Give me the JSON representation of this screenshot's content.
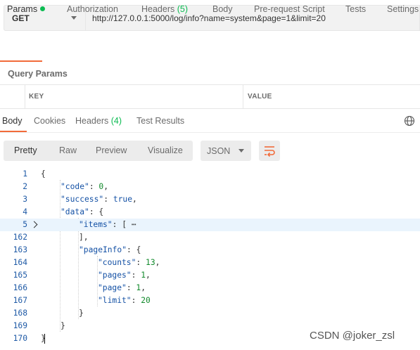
{
  "request": {
    "method": "GET",
    "url": "http://127.0.0.1:5000/log/info?name=system&page=1&limit=20"
  },
  "request_tabs": [
    {
      "label": "Params",
      "active": true,
      "indicator": "green-dot"
    },
    {
      "label": "Authorization"
    },
    {
      "label": "Headers",
      "count": "(5)"
    },
    {
      "label": "Body"
    },
    {
      "label": "Pre-request Script"
    },
    {
      "label": "Tests"
    },
    {
      "label": "Settings"
    }
  ],
  "query_params": {
    "title": "Query Params",
    "columns": [
      "KEY",
      "VALUE"
    ]
  },
  "response_tabs": [
    {
      "label": "Body",
      "active": true
    },
    {
      "label": "Cookies"
    },
    {
      "label": "Headers",
      "count": "(4)"
    },
    {
      "label": "Test Results"
    }
  ],
  "view_modes": [
    "Pretty",
    "Raw",
    "Preview",
    "Visualize"
  ],
  "format": "JSON",
  "icons": {
    "globe": "globe-icon",
    "wrap": "wrap-lines-icon",
    "fold": "chevron-right-icon"
  },
  "colors": {
    "accent": "#f26b3a",
    "green": "#0cbb52",
    "line_number": "#1f5aa6",
    "json_key": "#1451a5",
    "json_number": "#128a2c"
  },
  "code_lines": [
    {
      "num": "1",
      "text": "{"
    },
    {
      "num": "2",
      "text": "\"code\": 0,"
    },
    {
      "num": "3",
      "text": "\"success\": true,"
    },
    {
      "num": "4",
      "text": "\"data\": {"
    },
    {
      "num": "5",
      "text": "\"items\": [ ⋯"
    },
    {
      "num": "162",
      "text": "],"
    },
    {
      "num": "163",
      "text": "\"pageInfo\": {"
    },
    {
      "num": "164",
      "text": "\"counts\": 13,"
    },
    {
      "num": "165",
      "text": "\"pages\": 1,"
    },
    {
      "num": "166",
      "text": "\"page\": 1,"
    },
    {
      "num": "167",
      "text": "\"limit\": 20"
    },
    {
      "num": "168",
      "text": "}"
    },
    {
      "num": "169",
      "text": "}"
    },
    {
      "num": "170",
      "text": "}"
    }
  ],
  "watermark": "CSDN @joker_zsl"
}
